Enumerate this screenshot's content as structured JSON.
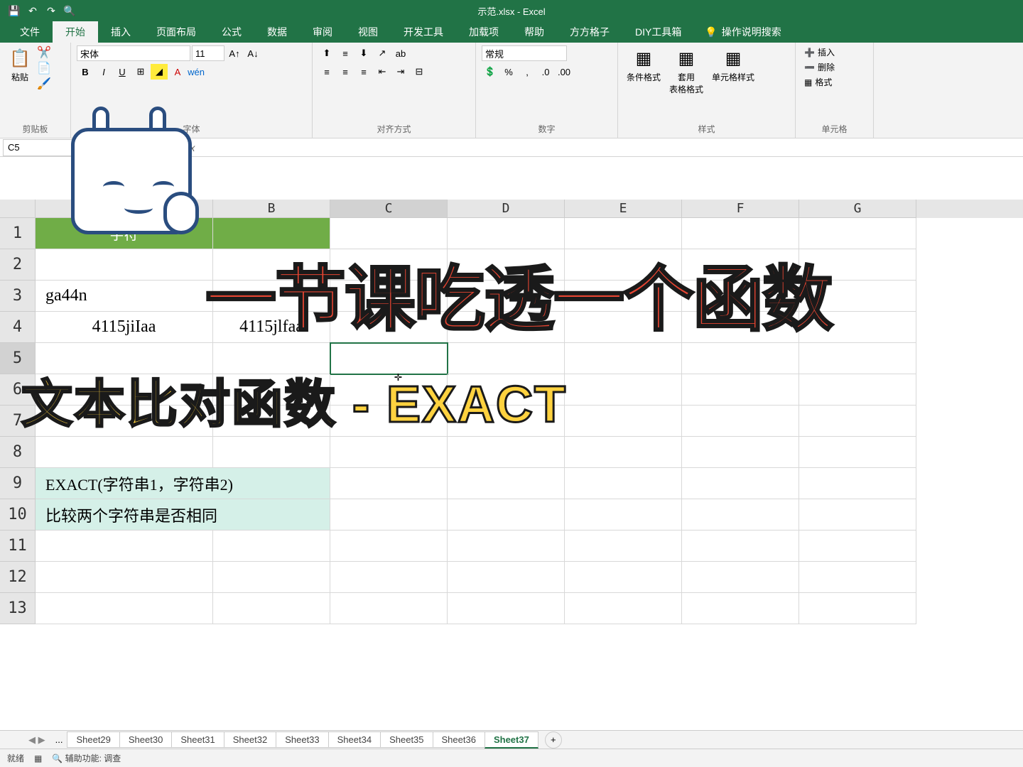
{
  "window": {
    "title": "示范.xlsx - Excel"
  },
  "qat": {
    "save": "💾",
    "undo": "↶",
    "redo": "↷",
    "preview": "🔍"
  },
  "tabs": [
    "文件",
    "开始",
    "插入",
    "页面布局",
    "公式",
    "数据",
    "审阅",
    "视图",
    "开发工具",
    "加载项",
    "帮助",
    "方方格子",
    "DIY工具箱"
  ],
  "tell_me": "操作说明搜索",
  "ribbon": {
    "clipboard": {
      "label": "剪贴板",
      "paste": "粘贴"
    },
    "font": {
      "label": "字体",
      "name": "宋体",
      "size": "11",
      "bold": "B",
      "italic": "I",
      "underline": "U",
      "wen": "wén"
    },
    "align": {
      "label": "对齐方式",
      "wrap": "ab"
    },
    "number": {
      "label": "数字",
      "format": "常规",
      "pct": "%",
      "comma": ",",
      "inc": ".0",
      "dec": ".00"
    },
    "styles": {
      "label": "样式",
      "cond": "条件格式",
      "table_fmt": "套用\n表格格式",
      "cell_style": "单元格样式"
    },
    "cells": {
      "label": "单元格",
      "insert": "插入",
      "delete": "删除",
      "format": "格式"
    }
  },
  "namebox": "C5",
  "columns": [
    "B",
    "C",
    "D",
    "E",
    "F",
    "G"
  ],
  "rows": [
    "1",
    "2",
    "3",
    "4",
    "5",
    "6",
    "7",
    "8",
    "9",
    "10",
    "11",
    "12",
    "13"
  ],
  "cells": {
    "A1": "字符",
    "A3": "ga44n",
    "A4": "4115jiIaa",
    "B4": "4115jlfaa",
    "A9": "EXACT(字符串1，字符串2)",
    "A10": "比较两个字符串是否相同"
  },
  "sheets": {
    "nav": "...",
    "list": [
      "Sheet29",
      "Sheet30",
      "Sheet31",
      "Sheet32",
      "Sheet33",
      "Sheet34",
      "Sheet35",
      "Sheet36",
      "Sheet37"
    ],
    "active": "Sheet37"
  },
  "status": {
    "ready": "就绪",
    "access": "辅助功能: 调查"
  },
  "overlay": {
    "title1": "一节课吃透一个函数",
    "title2": "文本比对函数 - EXACT"
  }
}
